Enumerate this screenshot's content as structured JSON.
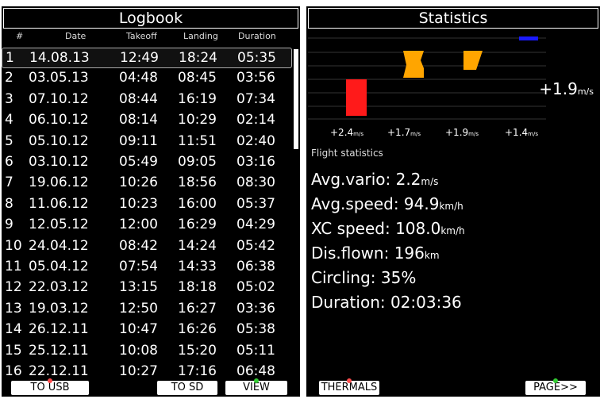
{
  "logbook": {
    "title": "Logbook",
    "columns": [
      "#",
      "Date",
      "Takeoff",
      "Landing",
      "Duration"
    ],
    "rows": [
      {
        "n": "1",
        "date": "14.08.13",
        "takeoff": "12:49",
        "landing": "18:24",
        "duration": "05:35"
      },
      {
        "n": "2",
        "date": "03.05.13",
        "takeoff": "04:48",
        "landing": "08:45",
        "duration": "03:56"
      },
      {
        "n": "3",
        "date": "07.10.12",
        "takeoff": "08:44",
        "landing": "16:19",
        "duration": "07:34"
      },
      {
        "n": "4",
        "date": "06.10.12",
        "takeoff": "08:14",
        "landing": "10:29",
        "duration": "02:14"
      },
      {
        "n": "5",
        "date": "05.10.12",
        "takeoff": "09:11",
        "landing": "11:51",
        "duration": "02:40"
      },
      {
        "n": "6",
        "date": "03.10.12",
        "takeoff": "05:49",
        "landing": "09:05",
        "duration": "03:16"
      },
      {
        "n": "7",
        "date": "19.06.12",
        "takeoff": "10:26",
        "landing": "18:56",
        "duration": "08:30"
      },
      {
        "n": "8",
        "date": "11.06.12",
        "takeoff": "10:23",
        "landing": "16:00",
        "duration": "05:37"
      },
      {
        "n": "9",
        "date": "12.05.12",
        "takeoff": "12:00",
        "landing": "16:29",
        "duration": "04:29"
      },
      {
        "n": "10",
        "date": "24.04.12",
        "takeoff": "08:42",
        "landing": "14:24",
        "duration": "05:42"
      },
      {
        "n": "11",
        "date": "05.04.12",
        "takeoff": "07:54",
        "landing": "14:33",
        "duration": "06:38"
      },
      {
        "n": "12",
        "date": "22.03.12",
        "takeoff": "13:15",
        "landing": "18:18",
        "duration": "05:02"
      },
      {
        "n": "13",
        "date": "19.03.12",
        "takeoff": "12:50",
        "landing": "16:27",
        "duration": "03:36"
      },
      {
        "n": "14",
        "date": "26.12.11",
        "takeoff": "10:47",
        "landing": "16:26",
        "duration": "05:38"
      },
      {
        "n": "15",
        "date": "25.12.11",
        "takeoff": "10:08",
        "landing": "15:20",
        "duration": "05:11"
      },
      {
        "n": "16",
        "date": "22.12.11",
        "takeoff": "10:27",
        "landing": "17:16",
        "duration": "06:48"
      }
    ],
    "buttons": {
      "to_usb": "TO USB",
      "to_sd": "TO SD",
      "view": "VIEW"
    }
  },
  "statistics": {
    "title": "Statistics",
    "current_vario": "+1.9",
    "vario_unit": "m/s",
    "bar_labels": [
      "+2.4",
      "+1.7",
      "+1.9",
      "+1.4"
    ],
    "bar_label_unit": "m/s",
    "section_title": "Flight statistics",
    "avg_vario_label": "Avg.vario: 2.2",
    "avg_vario_unit": "m/s",
    "avg_speed_label": "Avg.speed: 94.9",
    "avg_speed_unit": "km/h",
    "xc_speed_label": "XC speed: 108.0",
    "xc_speed_unit": "km/h",
    "dis_flown_label": "Dis.flown: 196",
    "dis_flown_unit": "km",
    "circling": "Circling: 35%",
    "duration": "Duration: 02:03:36",
    "buttons": {
      "thermals": "THERMALS",
      "page": "PAGE>>"
    }
  },
  "colors": {
    "red": "#ff1a1a",
    "orange": "#ffa500",
    "blue": "#1a1aff",
    "green": "#33cc33"
  }
}
